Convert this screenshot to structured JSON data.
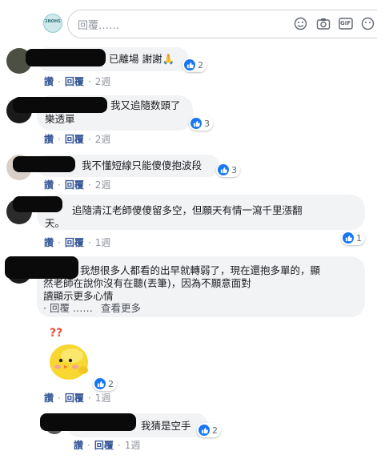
{
  "composer": {
    "avatar_text": "2NOHS",
    "placeholder": "回覆……",
    "icons": [
      "emoji-icon",
      "camera-icon",
      "gif-icon",
      "sticker-icon"
    ],
    "gif_label": "GIF"
  },
  "labels": {
    "like": "讚",
    "reply": "回覆",
    "sep": "·"
  },
  "comments": [
    {
      "text": "已離場 謝謝🙏",
      "reactions": "2",
      "time": "2週"
    },
    {
      "text_line1": "我又追隨数頭了",
      "text_line2": "樂透單",
      "reactions": "3",
      "time": "2週"
    },
    {
      "text": "我不懂短線只能傻傻抱波段",
      "reactions": "3",
      "time": "2週"
    },
    {
      "text_line1": "追隨清江老師傻傻留多空，但願天有情一瀉千里漲翻",
      "text_line2": "天。",
      "reactions": "1",
      "time": "1週"
    },
    {
      "text_line1": "我想很多人都看的出早就轉弱了，現在還抱多單的，顯",
      "text_line2": "然老師在說你沒有在聽(丟筆)，因為不願意面對",
      "see_more": "讀顯示更多心情",
      "reply_label": "· 回覆 ……",
      "view_more": "查看更多",
      "time": ""
    },
    {
      "sticker": "??",
      "reactions": "2",
      "time": "1週"
    },
    {
      "text": "我猜是空手",
      "reactions": "2",
      "time": "1週"
    }
  ],
  "colors": {
    "link_blue": "#385898",
    "like_blue": "#1877f2",
    "bubble_bg": "#f2f3f5",
    "meta_gray": "#90949c"
  }
}
